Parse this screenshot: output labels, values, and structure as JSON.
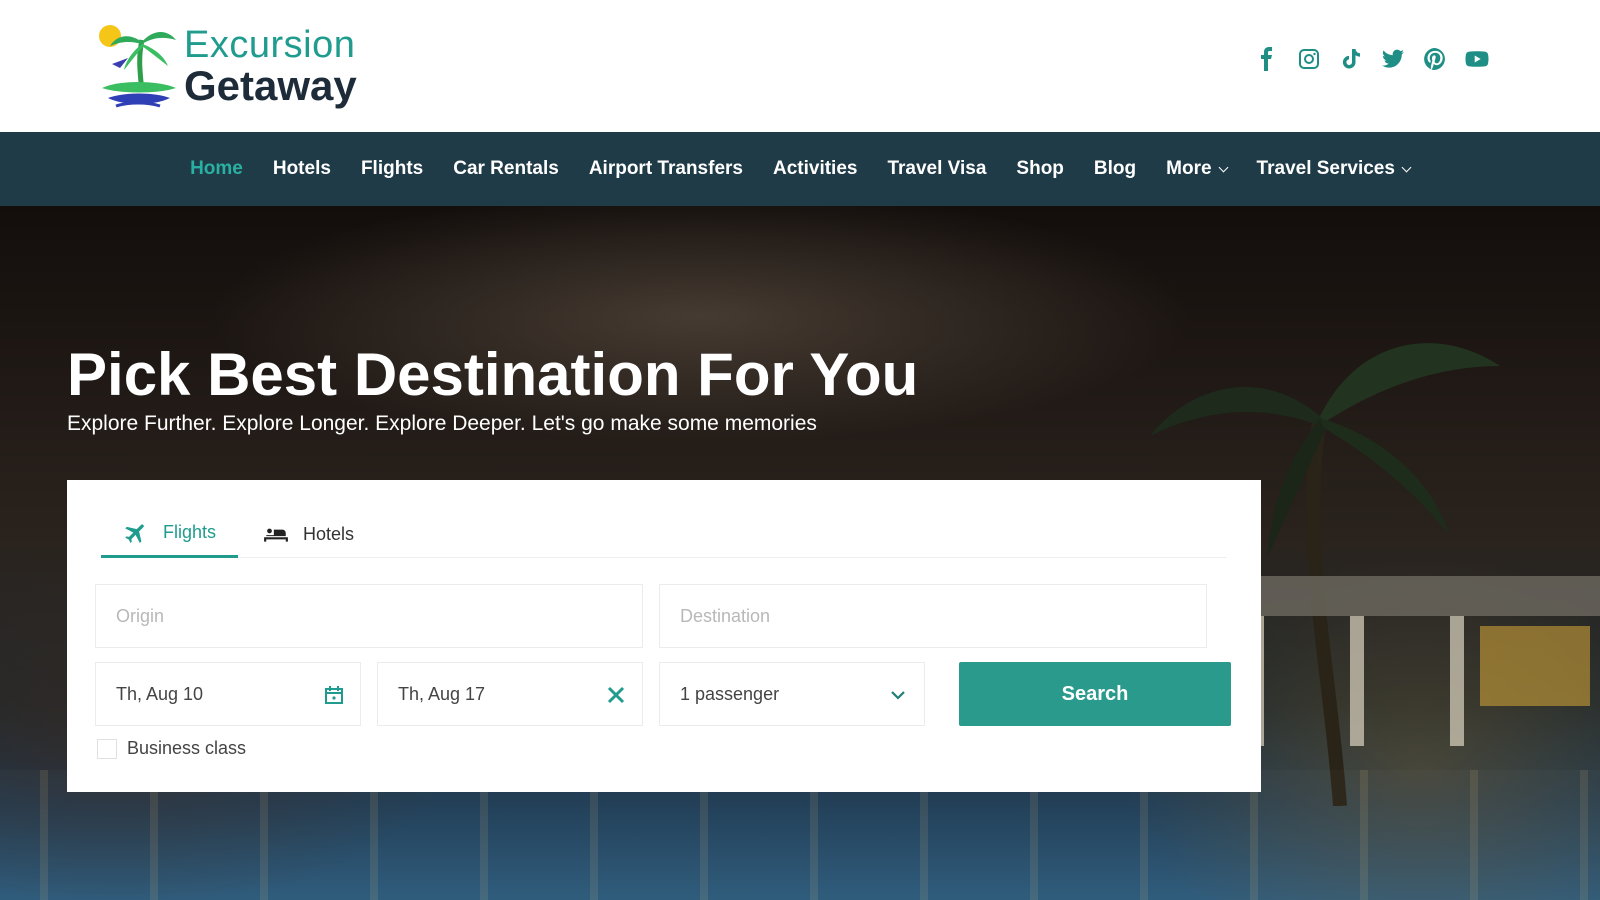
{
  "logo": {
    "line1": "Excursion",
    "line2": "Getaway"
  },
  "socials": [
    "facebook-icon",
    "instagram-icon",
    "tiktok-icon",
    "twitter-icon",
    "pinterest-icon",
    "youtube-icon"
  ],
  "nav": {
    "items": [
      {
        "label": "Home",
        "active": true
      },
      {
        "label": "Hotels"
      },
      {
        "label": "Flights"
      },
      {
        "label": "Car Rentals"
      },
      {
        "label": "Airport Transfers"
      },
      {
        "label": "Activities"
      },
      {
        "label": "Travel Visa"
      },
      {
        "label": "Shop"
      },
      {
        "label": "Blog"
      },
      {
        "label": "More",
        "dropdown": true
      },
      {
        "label": "Travel Services",
        "dropdown": true
      }
    ]
  },
  "hero": {
    "title": "Pick Best Destination For You",
    "subtitle": "Explore Further. Explore Longer. Explore Deeper. Let's go make some memories"
  },
  "search": {
    "tabs": [
      {
        "label": "Flights",
        "icon": "airplane-icon",
        "active": true
      },
      {
        "label": "Hotels",
        "icon": "bed-icon"
      }
    ],
    "origin_placeholder": "Origin",
    "destination_placeholder": "Destination",
    "depart_date": "Th, Aug 10",
    "return_date": "Th, Aug 17",
    "passengers": "1 passenger",
    "search_label": "Search",
    "business_class_label": "Business class",
    "business_class_checked": false
  },
  "colors": {
    "accent": "#1f9c8e",
    "nav_bg": "#1f3b47",
    "button": "#2a9a8c"
  }
}
